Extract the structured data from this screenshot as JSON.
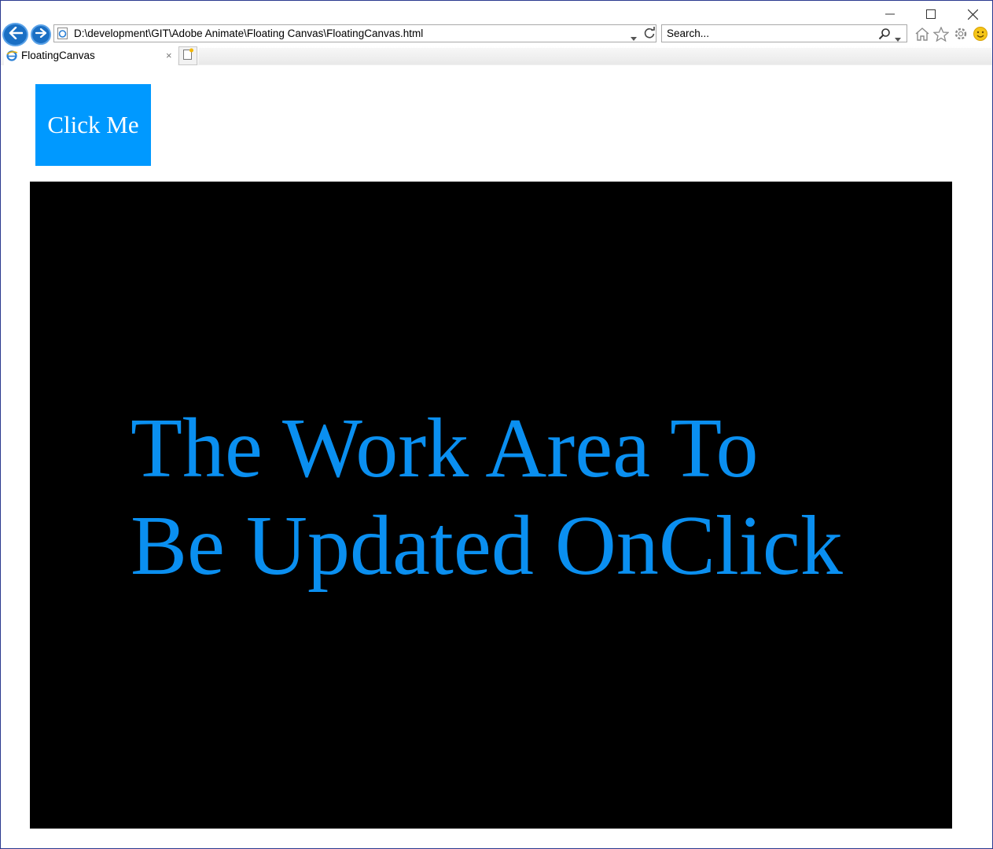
{
  "browser": {
    "address_url": "D:\\development\\GIT\\Adobe Animate\\Floating Canvas\\FloatingCanvas.html",
    "search_placeholder": "Search...",
    "tab": {
      "title": "FloatingCanvas",
      "close_symbol": "×"
    },
    "icons": {
      "back": "arrow-left-icon",
      "forward": "arrow-right-icon",
      "page": "ie-page-icon",
      "address_dropdown": "chevron-down-icon",
      "refresh": "refresh-icon",
      "search": "magnifier-icon",
      "search_dropdown": "chevron-down-icon",
      "home": "home-icon",
      "favorites": "star-icon",
      "tools": "gear-icon",
      "feedback": "smiley-icon",
      "new_tab": "new-tab-icon",
      "minimize": "minimize-icon",
      "maximize": "maximize-icon",
      "close": "close-icon"
    }
  },
  "page": {
    "button_label": "Click Me",
    "stage_text_line1": "The Work Area To",
    "stage_text_line2": "Be Updated OnClick"
  },
  "colors": {
    "button_bg": "#0099ff",
    "stage_bg": "#000000",
    "stage_text": "#0a8ff0"
  }
}
